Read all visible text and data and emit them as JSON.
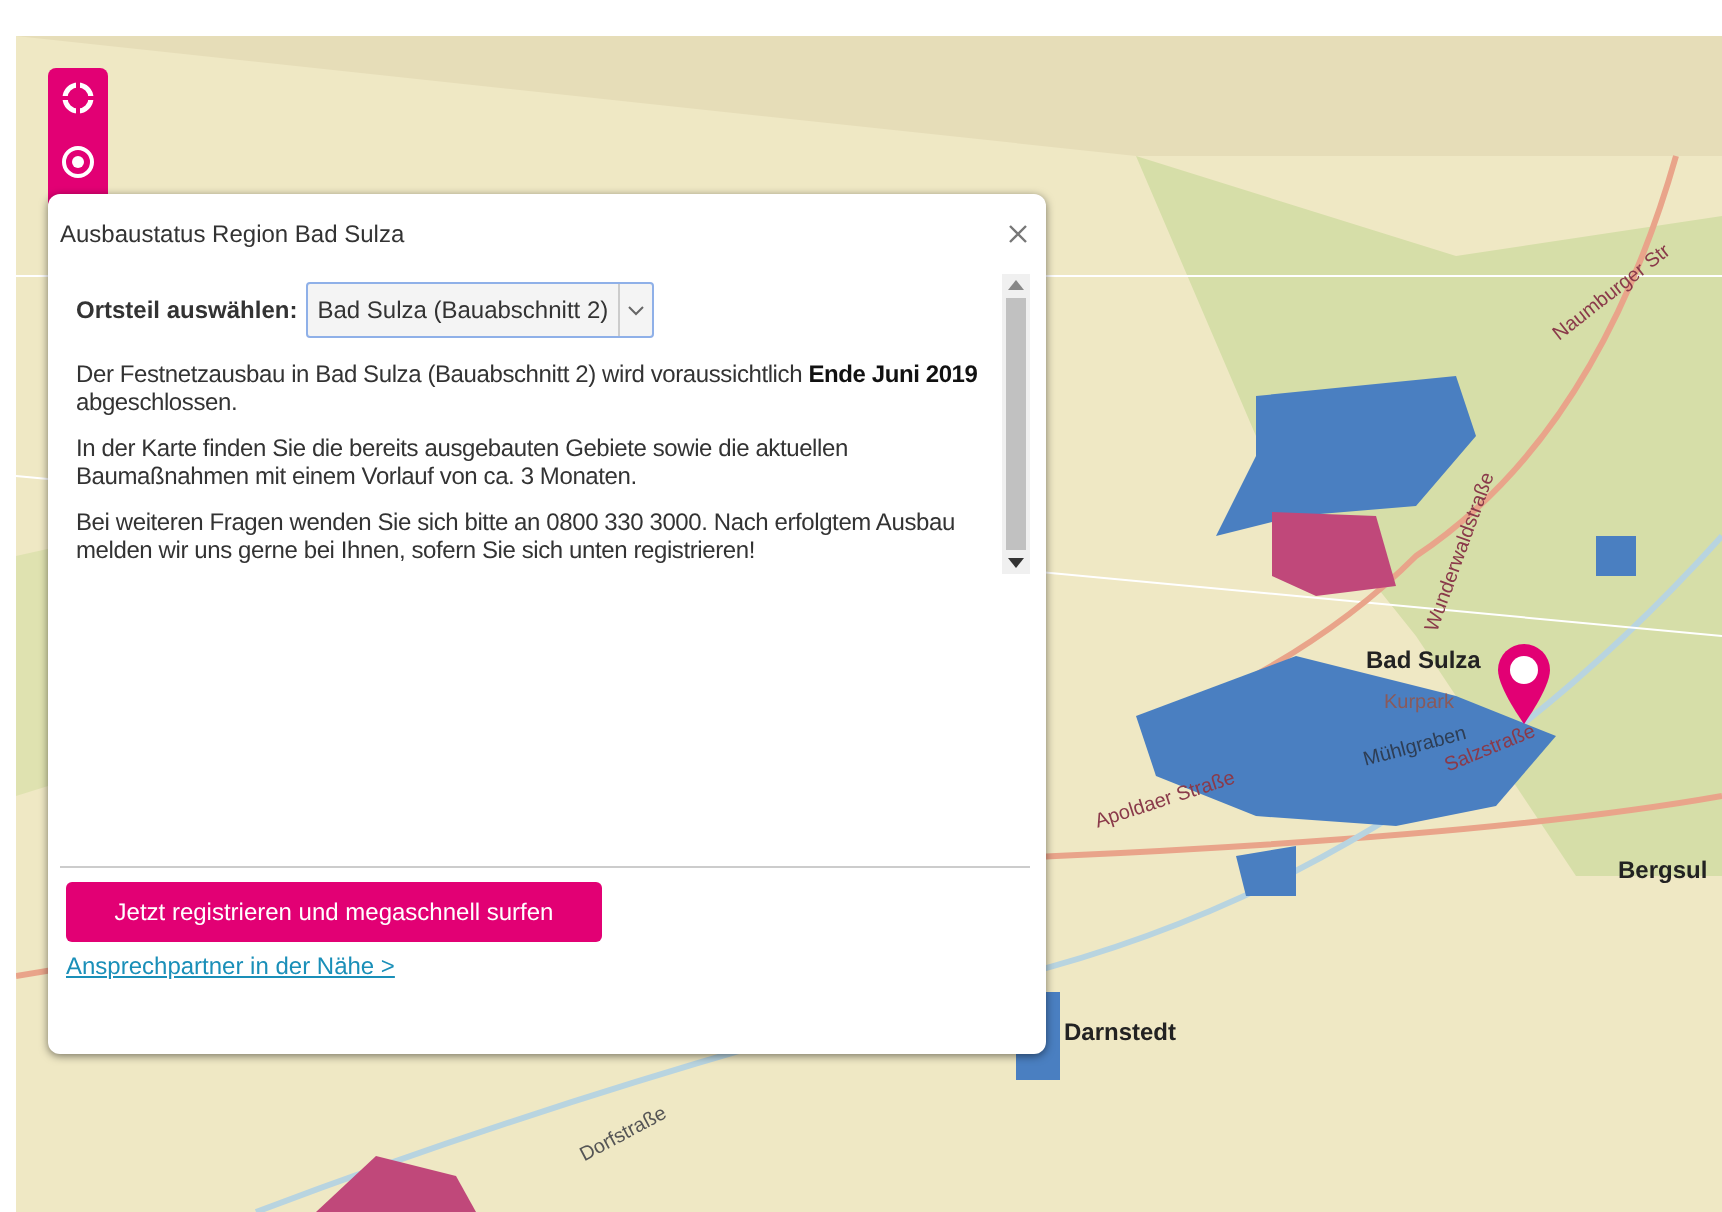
{
  "dialog": {
    "title": "Ausbaustatus Region Bad Sulza",
    "select_label": "Ortsteil auswählen:",
    "select_value": "Bad Sulza (Bauabschnitt 2)",
    "paragraphs": [
      "Der Festnetzausbau in Bad Sulza (Bauabschnitt 2) wird voraussichtlich **Ende Juni 2019** abgeschlossen.",
      "In der Karte finden Sie die bereits ausgebauten Gebiete sowie die aktuellen Baumaßnahmen mit einem Vorlauf von ca. 3 Monaten.",
      "Bei weiteren Fragen wenden Sie sich bitte an 0800 330 3000. Nach erfolgtem Ausbau melden wir uns gerne bei Ihnen, sofern Sie sich unten registrieren!"
    ],
    "register_button": "Jetzt registrieren und megaschnell surfen",
    "contact_link": "Ansprechpartner in der Nähe >"
  },
  "map_labels": [
    {
      "text": "Bad Sulza",
      "kind": "place"
    },
    {
      "text": "Kurpark",
      "kind": "park"
    },
    {
      "text": "Mühlgraben",
      "kind": "water"
    },
    {
      "text": "Salzstraße",
      "kind": "street"
    },
    {
      "text": "Apoldaer Straße",
      "kind": "street"
    },
    {
      "text": "Wunderwaldstraße",
      "kind": "street"
    },
    {
      "text": "Naumburger Str",
      "kind": "street"
    },
    {
      "text": "Bergsul",
      "kind": "place"
    },
    {
      "text": "Darnstedt",
      "kind": "place"
    },
    {
      "text": "Dorfstraße",
      "kind": "road"
    }
  ]
}
